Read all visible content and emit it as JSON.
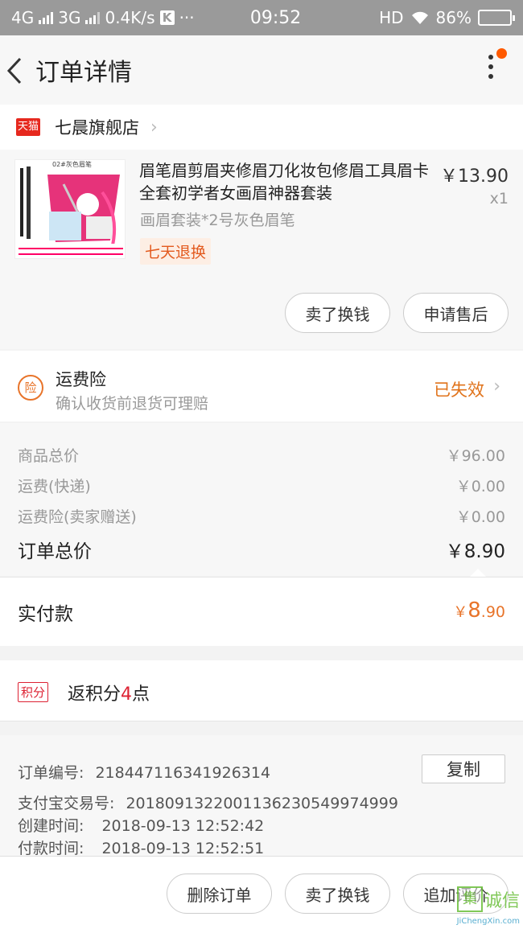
{
  "status_bar": {
    "net1": "4G",
    "net2": "3G",
    "speed": "0.4K/s",
    "k_badge": "K",
    "dots": "···",
    "time": "09:52",
    "hd": "HD",
    "battery": "86%",
    "battery_level": 0.86
  },
  "nav": {
    "title": "订单详情",
    "back_icon": "chevron-left-icon",
    "more_icon": "more-vertical-icon",
    "notification_color": "#ff5a00"
  },
  "shop": {
    "badge": "天猫",
    "name": "七晨旗舰店"
  },
  "item": {
    "title": "眉笔眉剪眉夹修眉刀化妆包修眉工具眉卡全套初学者女画眉神器套装",
    "price": "￥13.90",
    "quantity": "x1",
    "sku": "画眉套装*2号灰色眉笔",
    "tag": "七天退换",
    "image_label": "02#灰色眉笔",
    "btn_sell": "卖了换钱",
    "btn_after_sale": "申请售后"
  },
  "insurance": {
    "icon_text": "险",
    "title": "运费险",
    "subtitle": "确认收货前退货可理赔",
    "status": "已失效"
  },
  "costs": [
    {
      "label": "商品总价",
      "value": "￥96.00"
    },
    {
      "label": "运费(快递)",
      "value": "￥0.00"
    },
    {
      "label": "运费险(卖家赠送)",
      "value": "￥0.00"
    }
  ],
  "order_total": {
    "label": "订单总价",
    "value": "￥8.90"
  },
  "paid": {
    "label": "实付款",
    "currency": "￥",
    "integer": "8",
    "decimal": ".90"
  },
  "points": {
    "tag": "积分",
    "text_prefix": "返积分",
    "num": "4",
    "text_suffix": "点"
  },
  "info": {
    "order_no_label": "订单编号:",
    "order_no": "218447116341926314",
    "copy": "复制",
    "alipay_label": "支付宝交易号:",
    "alipay_no": "2018091322001136230549974999",
    "created_label": "创建时间:",
    "created": "2018-09-13 12:52:42",
    "paid_label": "付款时间:",
    "paid_time": "2018-09-13 12:52:51"
  },
  "bottom": {
    "delete": "删除订单",
    "sell": "卖了换钱",
    "review": "追加评价"
  },
  "watermark": {
    "icon": "集",
    "text": "诚信",
    "url": "JiChengXin.com"
  },
  "colors": {
    "accent": "#e8742a",
    "tmall": "#e6281e",
    "points": "#dd2233"
  }
}
